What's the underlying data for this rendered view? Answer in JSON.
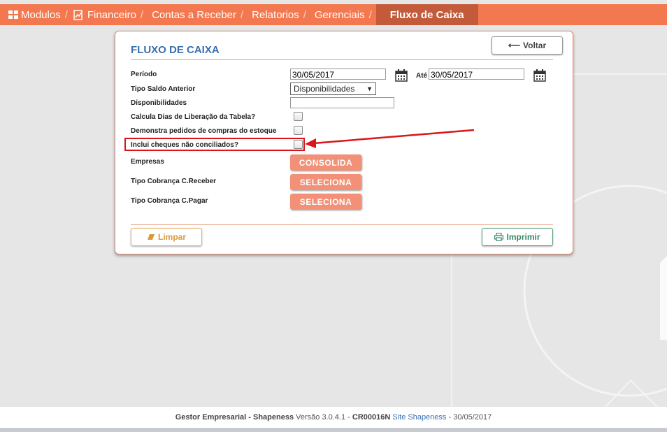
{
  "nav": {
    "items": [
      {
        "label": "Modulos",
        "icon": "grid-icon"
      },
      {
        "label": "Financeiro",
        "icon": "finance-report-icon"
      },
      {
        "label": "Contas a Receber"
      },
      {
        "label": "Relatorios"
      },
      {
        "label": "Gerenciais"
      }
    ],
    "separator": "/",
    "active": "Fluxo de Caixa",
    "color": "#f4784f",
    "active_color": "#c35a3a"
  },
  "panel": {
    "title": "FLUXO DE CAIXA",
    "back_button": "Voltar",
    "fields": {
      "periodo_label": "Período",
      "periodo_start": "30/05/2017",
      "ate_label": "Até",
      "periodo_end": "30/05/2017",
      "tipo_saldo_label": "Tipo Saldo Anterior",
      "tipo_saldo_value": "Disponibilidades",
      "disponibilidades_label": "Disponibilidades",
      "disponibilidades_value": "",
      "calcula_dias_label": "Calcula Dias de Liberação da Tabela?",
      "demonstra_pedidos_label": "Demonstra pedidos de compras do estoque",
      "inclui_cheques_label": "Inclui cheques não conciliados?",
      "empresas_label": "Empresas",
      "empresas_button": "CONSOLIDA",
      "tipo_receber_label": "Tipo Cobrança C.Receber",
      "tipo_receber_button": "SELECIONA",
      "tipo_pagar_label": "Tipo Cobrança C.Pagar",
      "tipo_pagar_button": "SELECIONA"
    },
    "checkboxes": {
      "calcula_dias": false,
      "demonstra_pedidos": false,
      "inclui_cheques": false
    },
    "clear_button": "Limpar",
    "print_button": "Imprimir",
    "accent_color": "#f29177"
  },
  "annotation": {
    "color": "#d9161b"
  },
  "footer": {
    "product": "Gestor Empresarial - Shapeness",
    "version_text": "Versão 3.0.4.1 -",
    "code": "CR00016N",
    "link": "Site Shapeness",
    "date_text": "- 30/05/2017"
  }
}
